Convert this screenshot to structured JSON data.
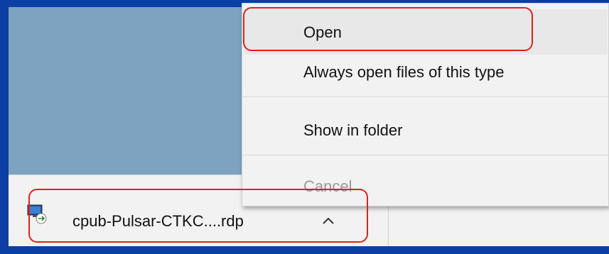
{
  "menu": {
    "items": [
      {
        "label": "Open",
        "disabled": false
      },
      {
        "label": "Always open files of this type",
        "disabled": false
      },
      {
        "label": "Show in folder",
        "disabled": false
      },
      {
        "label": "Cancel",
        "disabled": true
      }
    ]
  },
  "download": {
    "file_name": "cpub-Pulsar-CTKC....rdp",
    "icon": "remote-desktop-file-icon",
    "toggle_icon": "chevron-up-icon"
  },
  "colors": {
    "frame": "#0b3fa3",
    "page_background": "#7da3c1",
    "highlight": "#e0201c",
    "menu_background": "#f2f2f2"
  }
}
